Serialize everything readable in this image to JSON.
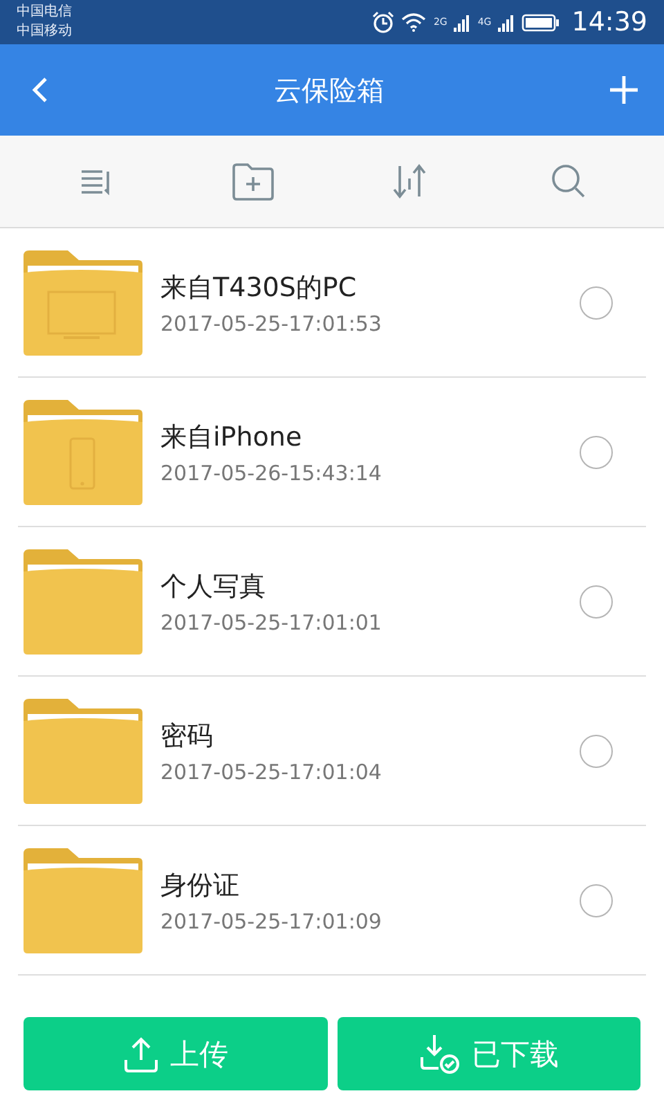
{
  "status_bar": {
    "carriers": [
      "中国电信",
      "中国移动"
    ],
    "network_1": "2G",
    "network_2": "4G",
    "time": "14:39"
  },
  "app_bar": {
    "title": "云保险箱"
  },
  "folders": [
    {
      "name": "来自T430S的PC",
      "date": "2017-05-25-17:01:53",
      "kind": "pc",
      "selected": false
    },
    {
      "name": "来自iPhone",
      "date": "2017-05-26-15:43:14",
      "kind": "phone",
      "selected": false
    },
    {
      "name": "个人写真",
      "date": "2017-05-25-17:01:01",
      "kind": "plain",
      "selected": false
    },
    {
      "name": "密码",
      "date": "2017-05-25-17:01:04",
      "kind": "plain",
      "selected": false
    },
    {
      "name": "身份证",
      "date": "2017-05-25-17:01:09",
      "kind": "plain",
      "selected": false
    }
  ],
  "buttons": [
    {
      "label": "上传",
      "kind": "upload"
    },
    {
      "label": "已下载",
      "kind": "downloaded"
    }
  ]
}
